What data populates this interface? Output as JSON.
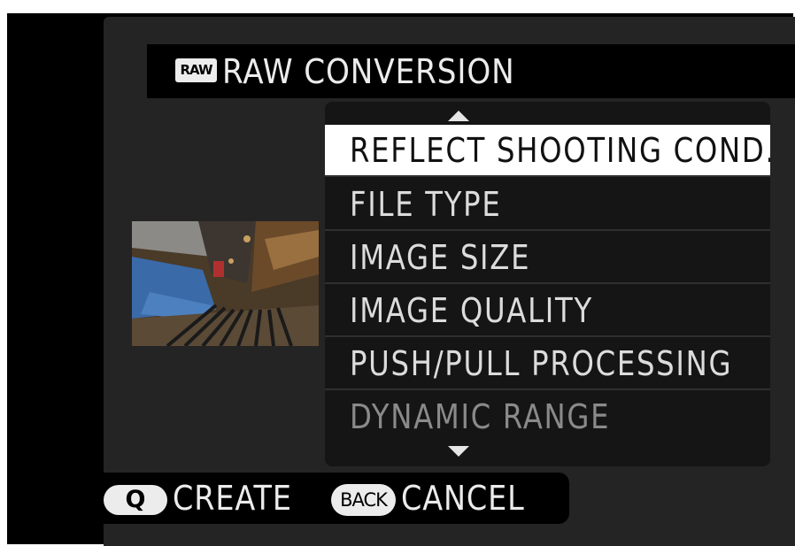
{
  "header": {
    "badge": "RAW",
    "title": "RAW CONVERSION"
  },
  "menu": {
    "items": [
      {
        "label": "REFLECT SHOOTING COND.",
        "state": "selected"
      },
      {
        "label": "FILE TYPE",
        "state": "normal"
      },
      {
        "label": "IMAGE SIZE",
        "state": "normal"
      },
      {
        "label": "IMAGE QUALITY",
        "state": "normal"
      },
      {
        "label": "PUSH/PULL PROCESSING",
        "state": "normal"
      },
      {
        "label": "DYNAMIC RANGE",
        "state": "dimmed"
      }
    ],
    "scroll_up_icon": "triangle-up",
    "scroll_down_icon": "triangle-down"
  },
  "preview": {
    "thumbnail_icon": "photo-thumbnail"
  },
  "footer": {
    "q_key": "Q",
    "create_label": "CREATE",
    "back_key": "BACK",
    "cancel_label": "CANCEL"
  },
  "colors": {
    "background": "#000000",
    "panel": "#242424",
    "menu_bg": "#151515",
    "selected_bg": "#ffffff",
    "text": "#dcdcdc",
    "dimmed_text": "#8a8a8a"
  }
}
